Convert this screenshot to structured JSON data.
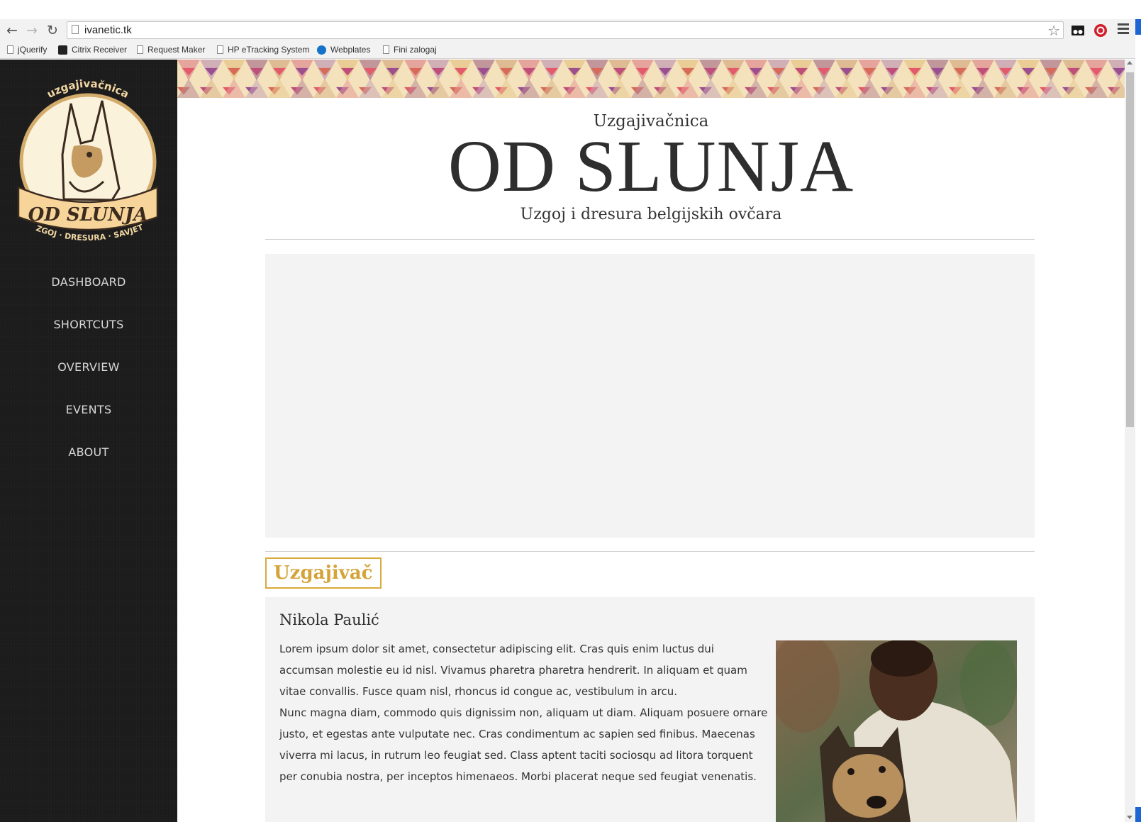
{
  "browser": {
    "url": "ivanetic.tk",
    "bookmarks": [
      "jQuerify",
      "Citrix Receiver",
      "Request Maker",
      "HP eTracking System",
      "Webplates",
      "Fini zalogaj"
    ]
  },
  "sidebar": {
    "logo": {
      "arc_text": "uzgajivačnica",
      "banner_text": "OD SLUNJA",
      "bottom_text": "UZGOJ · DRESURA · SAVJETI"
    },
    "nav": [
      {
        "label": "DASHBOARD"
      },
      {
        "label": "SHORTCUTS"
      },
      {
        "label": "OVERVIEW"
      },
      {
        "label": "EVENTS"
      },
      {
        "label": "ABOUT"
      }
    ]
  },
  "header": {
    "kicker": "Uzgajivačnica",
    "title": "OD SLUNJA",
    "tagline": "Uzgoj i dresura belgijskih ovčara"
  },
  "breeder": {
    "section_title": "Uzgajivač",
    "name": "Nikola Paulić",
    "paragraph1": "Lorem ipsum dolor sit amet, consectetur adipiscing elit. Cras quis enim luctus dui accumsan molestie eu id nisl. Vivamus pharetra pharetra hendrerit. In aliquam et quam vitae convallis. Fusce quam nisl, rhoncus id congue ac, vestibulum in arcu.",
    "paragraph2": "Nunc magna diam, commodo quis dignissim non, aliquam ut diam. Aliquam posuere ornare justo, et egestas ante vulputate nec. Cras condimentum ac sapien sed finibus. Maecenas viverra mi lacus, in rutrum leo feugiat sed. Class aptent taciti sociosqu ad litora torquent per conubia nostra, per inceptos himenaeos. Morbi placerat neque sed feugiat venenatis."
  },
  "colors": {
    "sidebar_bg": "#1b1b1b",
    "accent_gold": "#d4a43a",
    "panel_bg": "#f3f3f3"
  }
}
